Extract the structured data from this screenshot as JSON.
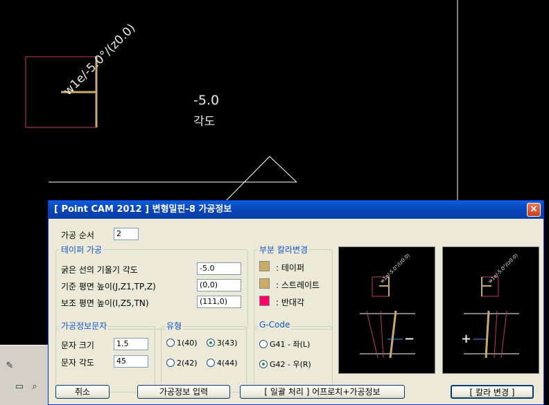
{
  "canvas": {
    "rotated_label": "w1e/-5.0°/(z0.0)",
    "value_text": "-5.0",
    "value_caption": "각도"
  },
  "dialog": {
    "title": "[ Point CAM 2012 ] 변형밀핀-8 가공정보",
    "close_icon": "×",
    "order_label": "가공 순서",
    "order_value": "2",
    "taper_group": {
      "title": "테이퍼 가공",
      "rows": [
        {
          "label": "굵은 선의 기울기 각도",
          "value": "-5.0"
        },
        {
          "label": "기준 평면 높이(J,Z1,TP,Z)",
          "value": "(0,0)"
        },
        {
          "label": "보조 평면 높이(I,Z5,TN)",
          "value": "(111,0)"
        }
      ]
    },
    "color_group": {
      "title": "부분 칼라변경",
      "items": [
        {
          "label": ": 테이퍼",
          "color": "#c9ab6a"
        },
        {
          "label": ": 스트레이트",
          "color": "#c9ab6a"
        },
        {
          "label": ": 반대각",
          "color": "#ff0066"
        }
      ]
    },
    "text_group": {
      "title": "가공정보문자",
      "size_label": "문자 크기",
      "size_value": "1.5",
      "angle_label": "문자 각도",
      "angle_value": "45"
    },
    "type_group": {
      "title": "유형",
      "options": [
        {
          "label": "1(40)",
          "selected": false
        },
        {
          "label": "3(43)",
          "selected": true
        },
        {
          "label": "2(42)",
          "selected": false
        },
        {
          "label": "4(44)",
          "selected": false
        }
      ]
    },
    "gcode_group": {
      "title": "G-Code",
      "options": [
        {
          "label": "G41 - 좌(L)",
          "selected": false
        },
        {
          "label": "G42 - 우(R)",
          "selected": true
        }
      ]
    },
    "preview_left_label": "w1e/-5.0°/(z0.0)",
    "preview_right_label": "w1e/-5.0°/(z0.0)",
    "preview_left_sign": "−",
    "preview_right_sign": "+",
    "buttons": {
      "cancel": "취소",
      "input": "가공정보 입력",
      "batch": "[ 일괄 처리 ]  어프로치+가공정보",
      "color_change": "[ 칼라 변경 ]"
    }
  },
  "colors": {
    "accent_gold": "#c9ab6a",
    "accent_pink": "#ff0066",
    "title_blue": "#0845b8"
  }
}
